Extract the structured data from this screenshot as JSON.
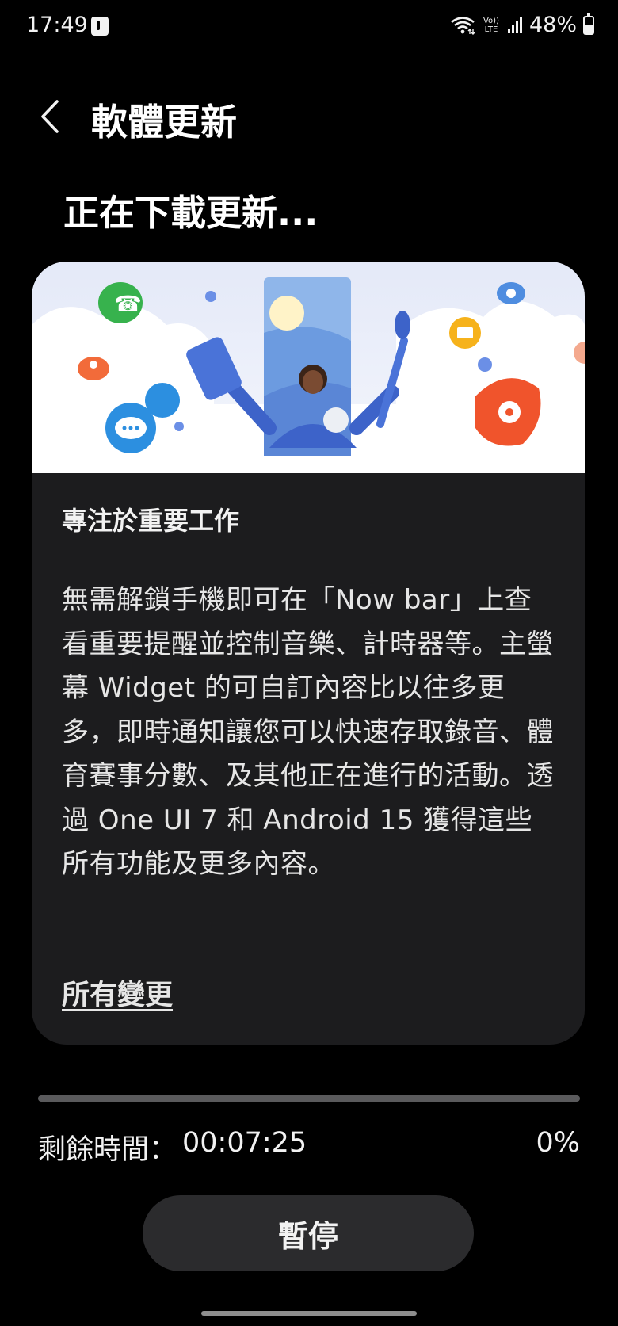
{
  "status_bar": {
    "time": "17:49",
    "notification_icon": "tiktok-icon",
    "wifi_icon": "wifi-6-icon",
    "volte_line1": "Vo))",
    "volte_line2": "LTE",
    "signal_icon": "cellular-signal-icon",
    "battery_percent": "48%",
    "battery_level": 0.48
  },
  "header": {
    "back_icon": "chevron-left-icon",
    "title": "軟體更新"
  },
  "status_heading": "正在下載更新...",
  "card": {
    "headline": "專注於重要工作",
    "body": "無需解鎖手機即可在「Now bar」上查看重要提醒並控制音樂、計時器等。主螢幕 Widget 的可自訂內容比以往多更多，即時通知讓您可以快速存取錄音、體育賽事分數、及其他正在進行的活動。透過 One UI 7 和 Android 15 獲得這些所有功能及更多內容。",
    "link": "所有變更"
  },
  "progress": {
    "fraction": 0,
    "remaining_label": "剩餘時間：",
    "remaining_value": "00:07:25",
    "percent": "0%"
  },
  "pause_button": "暫停",
  "colors": {
    "background": "#000000",
    "card": "#1c1c1e",
    "button": "#2b2b2d",
    "progress_track": "#5a5a5c"
  }
}
